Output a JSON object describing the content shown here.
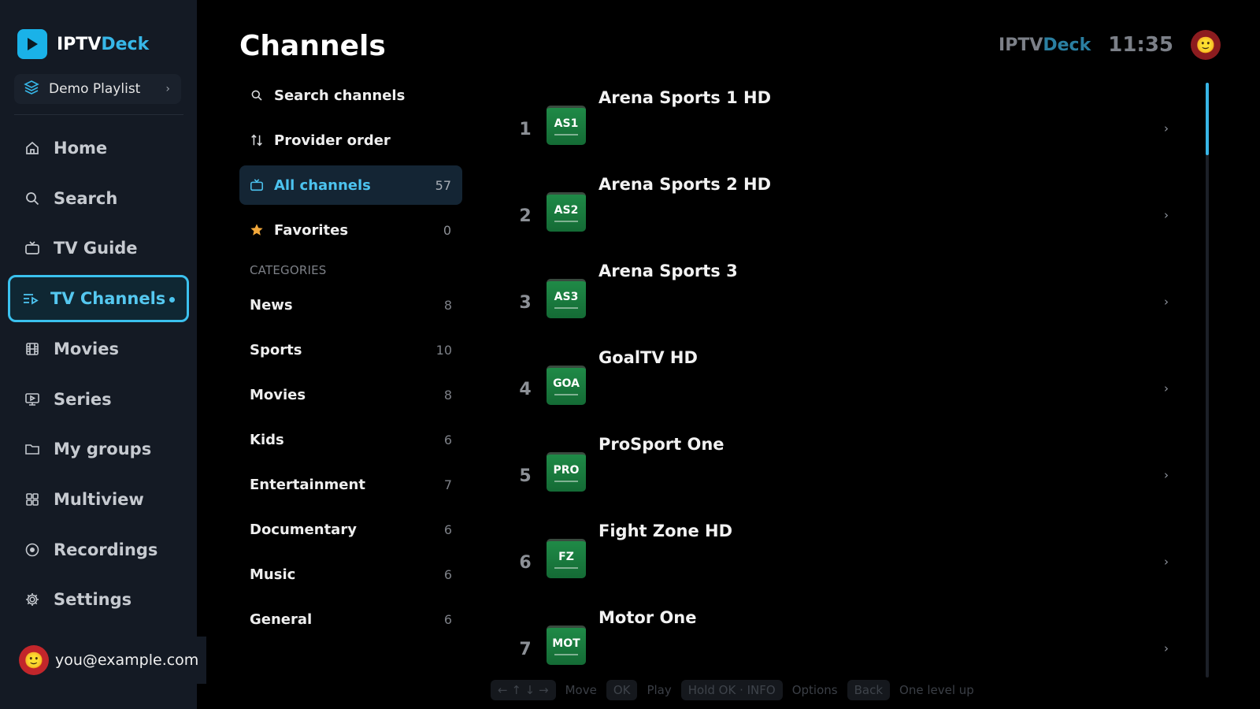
{
  "sidebar": {
    "brand": {
      "prefix": "IPTV",
      "accent": "Deck"
    },
    "playlist": {
      "label": "Demo Playlist"
    },
    "nav": [
      {
        "id": "home",
        "label": "Home",
        "icon": "home-icon"
      },
      {
        "id": "search",
        "label": "Search",
        "icon": "search-icon"
      },
      {
        "id": "tv-guide",
        "label": "TV Guide",
        "icon": "tv-icon"
      },
      {
        "id": "tv-channels",
        "label": "TV Channels",
        "icon": "list-play-icon",
        "active": true
      },
      {
        "id": "movies",
        "label": "Movies",
        "icon": "film-icon"
      },
      {
        "id": "series",
        "label": "Series",
        "icon": "monitor-play-icon"
      },
      {
        "id": "my-groups",
        "label": "My groups",
        "icon": "folder-icon"
      },
      {
        "id": "multiview",
        "label": "Multiview",
        "icon": "grid-icon"
      },
      {
        "id": "recordings",
        "label": "Recordings",
        "icon": "record-icon"
      },
      {
        "id": "settings",
        "label": "Settings",
        "icon": "gear-icon"
      }
    ],
    "user": {
      "email": "you@example.com",
      "avatar": "🙂"
    }
  },
  "header": {
    "title": "Channels",
    "brand": {
      "prefix": "IPTV",
      "accent": "Deck"
    },
    "time": "11:35",
    "avatar": "🙂"
  },
  "filters": {
    "search": "Search channels",
    "order": "Provider order",
    "all": {
      "label": "All channels",
      "count": "57"
    },
    "favorites": {
      "label": "Favorites",
      "count": "0"
    }
  },
  "categories": {
    "heading": "CATEGORIES",
    "items": [
      {
        "label": "News",
        "count": "8"
      },
      {
        "label": "Sports",
        "count": "10"
      },
      {
        "label": "Movies",
        "count": "8"
      },
      {
        "label": "Kids",
        "count": "6"
      },
      {
        "label": "Entertainment",
        "count": "7"
      },
      {
        "label": "Documentary",
        "count": "6"
      },
      {
        "label": "Music",
        "count": "6"
      },
      {
        "label": "General",
        "count": "6"
      }
    ]
  },
  "channels": [
    {
      "num": "1",
      "name": "Arena Sports 1 HD",
      "abbr": "AS1"
    },
    {
      "num": "2",
      "name": "Arena Sports 2 HD",
      "abbr": "AS2"
    },
    {
      "num": "3",
      "name": "Arena Sports 3",
      "abbr": "AS3"
    },
    {
      "num": "4",
      "name": "GoalTV HD",
      "abbr": "GOA"
    },
    {
      "num": "5",
      "name": "ProSport One",
      "abbr": "PRO"
    },
    {
      "num": "6",
      "name": "Fight Zone HD",
      "abbr": "FZ"
    },
    {
      "num": "7",
      "name": "Motor One",
      "abbr": "MOT"
    }
  ],
  "hints": {
    "move_key": "← ↑ ↓ →",
    "move": "Move",
    "ok_key": "OK",
    "play": "Play",
    "hold_key": "Hold OK · INFO",
    "options": "Options",
    "back_key": "Back",
    "back": "One level up"
  },
  "colors": {
    "accent": "#3bc1ee",
    "sidebar_bg": "#141a24",
    "channel_logo": "#1f8a47",
    "favorite_star": "#f2a83b"
  }
}
